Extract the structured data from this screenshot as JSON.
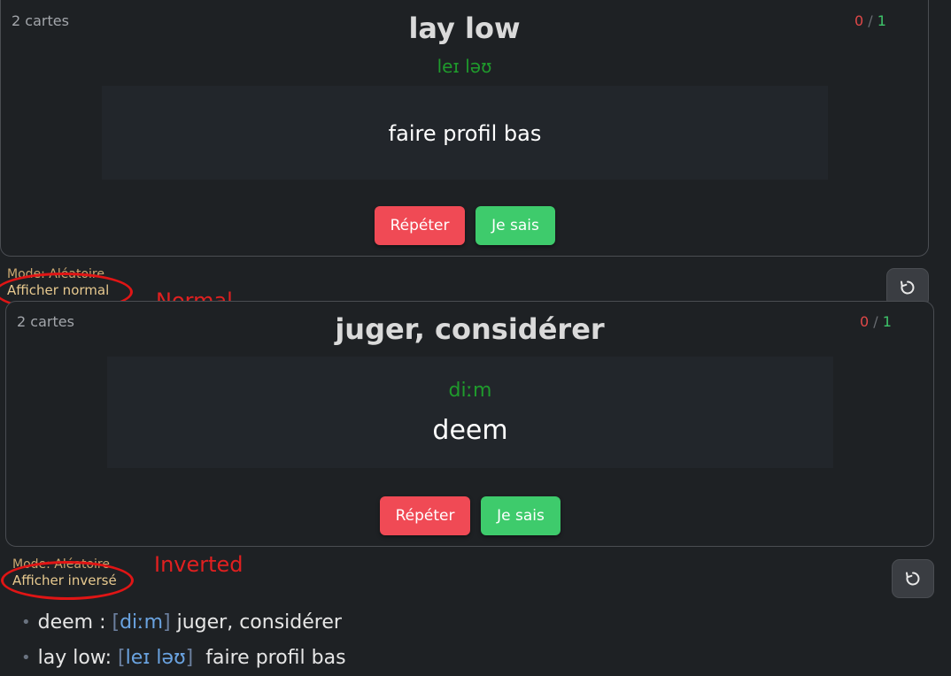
{
  "card1": {
    "count": "2 cartes",
    "score_wrong": "0",
    "score_sep": "/",
    "score_right": "1",
    "title": "lay low",
    "phonetic": "leɪ ləʊ",
    "answer": "faire profil bas",
    "repeat_label": "Répéter",
    "know_label": "Je sais"
  },
  "controls1": {
    "mode": "Mode: Aléatoire",
    "display": "Afficher normal",
    "annotation": "Normal"
  },
  "card2": {
    "count": "2 cartes",
    "score_wrong": "0",
    "score_sep": "/",
    "score_right": "1",
    "title": "juger, considérer",
    "phonetic": "diːm",
    "answer": "deem",
    "repeat_label": "Répéter",
    "know_label": "Je sais"
  },
  "controls2": {
    "mode": "Mode: Aléatoire",
    "display": "Afficher inversé",
    "annotation": "Inverted"
  },
  "reset_icon": "reset-rotate-icon",
  "word_list": [
    {
      "word": "deem :",
      "bracket_open": "[",
      "ipa": "diːm",
      "bracket_close": "]",
      "meaning": "juger, considérer"
    },
    {
      "word": "lay low:",
      "bracket_open": "[",
      "ipa": "leɪ ləʊ",
      "bracket_close": "]",
      "meaning": "faire profil bas"
    }
  ],
  "colors": {
    "repeat": "#f04a55",
    "know": "#3ecb6c",
    "phonetic": "#1f9a2c",
    "annotation": "#e02020"
  }
}
